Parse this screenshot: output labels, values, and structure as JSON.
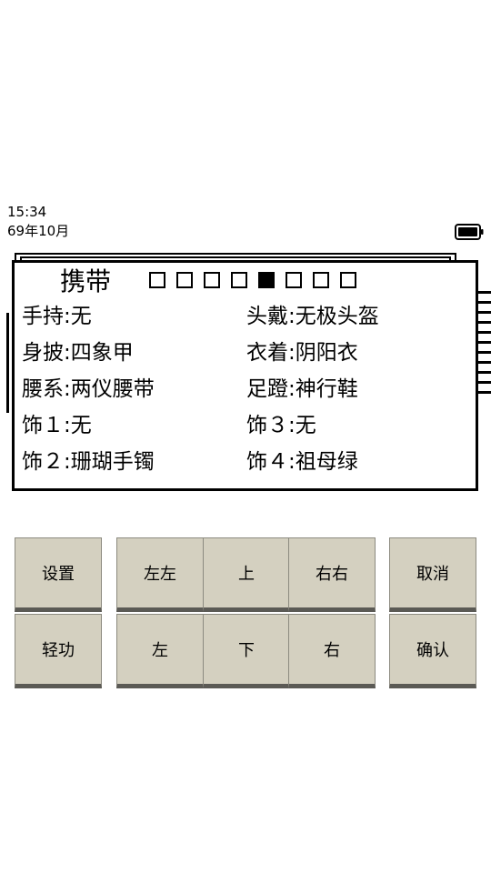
{
  "status": {
    "time": "15:34",
    "date": "69年10月",
    "battery_icon": "battery-full-icon"
  },
  "panel": {
    "title": "携带",
    "slots": {
      "count": 8,
      "active_index": 4
    },
    "left_slots": [
      {
        "label": "手持:无"
      },
      {
        "label": "身披:四象甲"
      },
      {
        "label": "腰系:两仪腰带"
      },
      {
        "label": "饰１:无"
      },
      {
        "label": "饰２:珊瑚手镯"
      }
    ],
    "right_slots": [
      {
        "label": "头戴:无极头盔"
      },
      {
        "label": "衣着:阴阳衣"
      },
      {
        "label": "足蹬:神行鞋"
      },
      {
        "label": "饰３:无"
      },
      {
        "label": "饰４:祖母绿"
      }
    ]
  },
  "buttons": {
    "settings": "设置",
    "left_left": "左左",
    "up": "上",
    "right_right": "右右",
    "cancel": "取消",
    "qinggong": "轻功",
    "left": "左",
    "down": "下",
    "right": "右",
    "confirm": "确认"
  },
  "colors": {
    "button_face": "#d4d0c0",
    "button_shadow": "#5b5a55"
  }
}
